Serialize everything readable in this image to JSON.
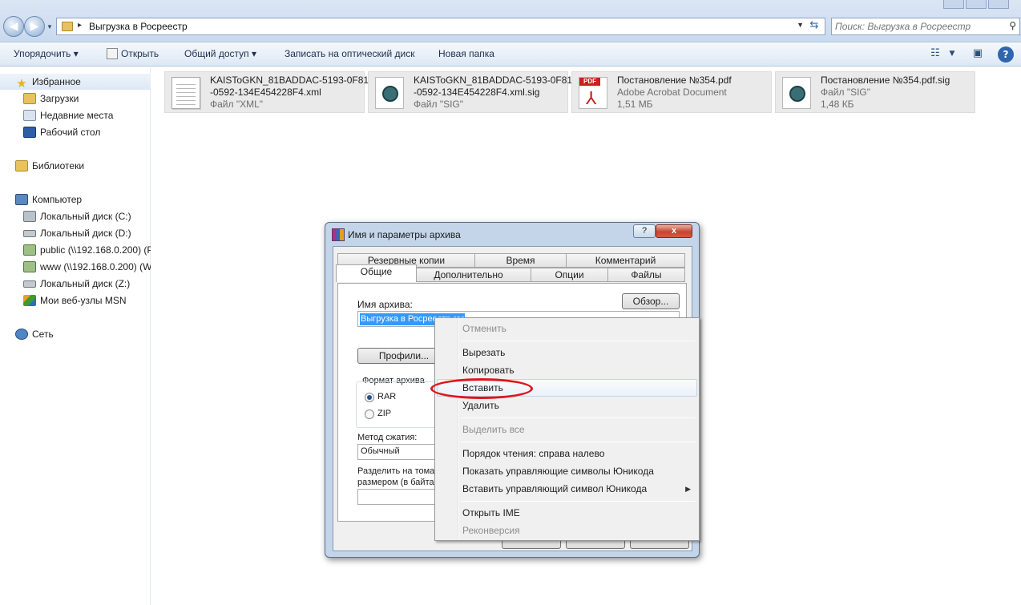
{
  "window": {
    "title": "Выгрузка в Росреестр"
  },
  "address": {
    "path": "Выгрузка в Росреестр"
  },
  "search": {
    "placeholder": "Поиск: Выгрузка в Росреестр"
  },
  "toolbar": {
    "organize": "Упорядочить",
    "open": "Открыть",
    "share": "Общий доступ",
    "burn": "Записать на оптический диск",
    "new_folder": "Новая папка"
  },
  "sidebar": {
    "favorites": "Избранное",
    "downloads": "Загрузки",
    "recent": "Недавние места",
    "desktop": "Рабочий стол",
    "libraries": "Библиотеки",
    "computer": "Компьютер",
    "drive_c": "Локальный диск (C:)",
    "drive_d": "Локальный диск (D:)",
    "net_public": "public (\\\\192.168.0.200) (P",
    "net_www": "www (\\\\192.168.0.200) (W:",
    "drive_z": "Локальный диск (Z:)",
    "msn": "Мои веб-узлы MSN",
    "network": "Сеть"
  },
  "files": [
    {
      "name1": "KAISToGKN_81BADDAC-5193-0F81",
      "name2": "-0592-134E454228F4.xml",
      "type": "Файл \"XML\"",
      "icon": "xml-document-icon"
    },
    {
      "name1": "KAISToGKN_81BADDAC-5193-0F81",
      "name2": "-0592-134E454228F4.xml.sig",
      "type": "Файл \"SIG\"",
      "icon": "sig-certificate-icon"
    },
    {
      "name1": "Постановление №354.pdf",
      "name2": "Adobe Acrobat Document",
      "type": "1,51 МБ",
      "icon": "pdf-icon"
    },
    {
      "name1": "Постановление №354.pdf.sig",
      "name2": "Файл \"SIG\"",
      "type": "1,48 КБ",
      "icon": "sig-certificate-icon"
    }
  ],
  "dialog": {
    "title": "Имя и параметры архива",
    "help": "?",
    "close": "x",
    "tabs_top": [
      "Резервные копии",
      "Время",
      "Комментарий"
    ],
    "tabs_bottom": [
      "Общие",
      "Дополнительно",
      "Опции",
      "Файлы"
    ],
    "archive_name_label": "Имя архива:",
    "browse": "Обзор...",
    "archive_name_value": "Выгрузка в Росреестр.rar",
    "profiles": "Профили...",
    "format_label": "Формат архива",
    "format_rar": "RAR",
    "format_zip": "ZIP",
    "format_selected": "RAR",
    "method_label": "Метод сжатия:",
    "method_value": "Обычный",
    "split_label1": "Разделить на тома",
    "split_label2": "размером (в байтах)"
  },
  "context_menu": {
    "undo": "Отменить",
    "cut": "Вырезать",
    "copy": "Копировать",
    "paste": "Вставить",
    "delete": "Удалить",
    "select_all": "Выделить все",
    "rtl": "Порядок чтения: справа налево",
    "show_unicode": "Показать управляющие символы Юникода",
    "insert_unicode": "Вставить управляющий символ Юникода",
    "open_ime": "Открыть IME",
    "reconversion": "Реконверсия"
  },
  "colors": {
    "highlight_circle": "#e0141c",
    "selection": "#3399ff"
  }
}
